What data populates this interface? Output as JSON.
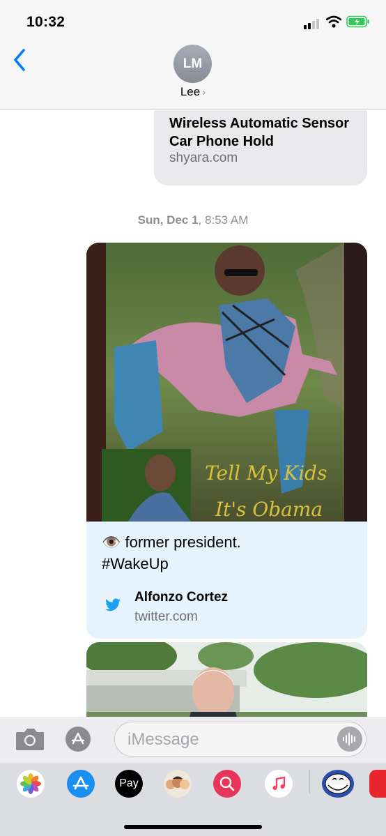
{
  "status_bar": {
    "time": "10:32",
    "icons": [
      "cellular-signal-icon",
      "wifi-icon",
      "battery-charging-icon"
    ],
    "battery_color": "#34c759"
  },
  "header": {
    "back_icon": "chevron-left-icon",
    "avatar_initials": "LM",
    "contact_name": "Lee",
    "contact_chevron": "›",
    "accent_color": "#007aff"
  },
  "messages": {
    "link_preview_1": {
      "title": "Wireless Automatic Sensor Car Phone Hold",
      "domain": "shyara.com"
    },
    "timestamp": {
      "day": "Sun, Dec 1",
      "time": ", 8:53 AM"
    },
    "tweet_preview": {
      "image_overlay_text_line1": "Tell My Kids",
      "image_overlay_text_line2": "It's Obama",
      "text_line1": "👁️  former president.",
      "text_line2": "#WakeUp",
      "author": "Alfonzo Cortez",
      "domain": "twitter.com",
      "icon": "twitter-bird-icon",
      "background_color": "#e6f3fc"
    },
    "video_preview": {
      "icon": "video-thumbnail"
    }
  },
  "input_bar": {
    "camera_icon": "camera-icon",
    "apps_icon": "app-store-icon",
    "placeholder": "iMessage",
    "audio_icon": "audio-waveform-icon"
  },
  "app_drawer": {
    "apps": [
      {
        "name": "photos-app-icon"
      },
      {
        "name": "app-store-app-icon"
      },
      {
        "name": "apple-pay-app-icon",
        "label": "Pay"
      },
      {
        "name": "memoji-app-icon"
      },
      {
        "name": "web-search-app-icon"
      },
      {
        "name": "music-app-icon"
      },
      {
        "name": "troll-sticker-app-icon"
      },
      {
        "name": "partial-app-icon"
      }
    ]
  }
}
